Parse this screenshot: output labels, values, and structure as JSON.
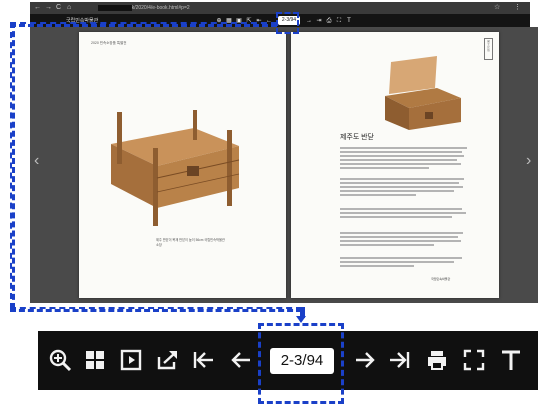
{
  "browser": {
    "url": "fe/ebook/ebook/2020/4/e-book.html#p=2",
    "nav_buttons": [
      "←",
      "→",
      "C",
      "⌂"
    ],
    "menu_icons": [
      "☆",
      "⋮"
    ]
  },
  "viewer": {
    "brand": "국립민속박물관",
    "page_indicator": "2-3/94"
  },
  "zoom_toolbar": {
    "page_indicator": "2-3/94",
    "tools": [
      "zoom-in",
      "thumbnails",
      "slideshow",
      "share",
      "first-page",
      "previous-page",
      "next-page",
      "last-page",
      "print",
      "fullscreen",
      "text"
    ]
  },
  "book": {
    "left_page": {
      "header": "2020 민속소장품 특별전",
      "caption": "제주 반닫이 목재 반닫이 높이 56cm 국립민속박물관 소장"
    },
    "right_page": {
      "title": "제주도 반닫",
      "signature": "국립민속박물관"
    }
  },
  "colors": {
    "annotation": "#1a40c8",
    "toolbar_bg": "#101010",
    "viewer_bg": "#4a4a4a",
    "wood": "#b07a43"
  }
}
